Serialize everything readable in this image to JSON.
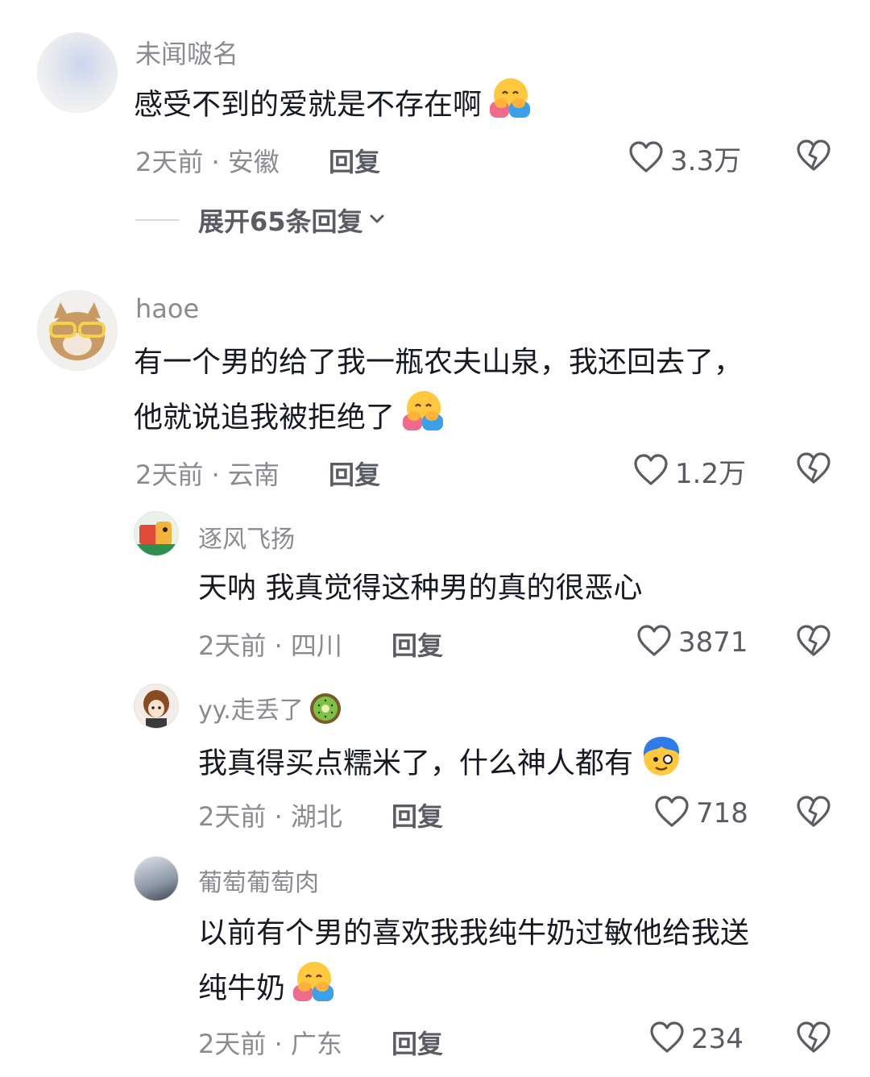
{
  "comments": [
    {
      "user": "未闻啵名",
      "text": "感受不到的爱就是不存在啊",
      "meta": "2天前 · 安徽",
      "reply": "回复",
      "likes": "3.3万",
      "expand": "展开65条回复"
    },
    {
      "user": "haoe",
      "text_line1": "有一个男的给了我一瓶农夫山泉，我还回去了，",
      "text_line2": "他就说追我被拒绝了",
      "meta": "2天前 · 云南",
      "reply": "回复",
      "likes": "1.2万",
      "replies": [
        {
          "user": "逐风飞扬",
          "text": "天呐 我真觉得这种男的真的很恶心",
          "meta": "2天前 · 四川",
          "reply": "回复",
          "likes": "3871"
        },
        {
          "user": "yy.走丢了",
          "text": "我真得买点糯米了，什么神人都有",
          "meta": "2天前 · 湖北",
          "reply": "回复",
          "likes": "718"
        },
        {
          "user": "葡萄葡萄肉",
          "text_line1": "以前有个男的喜欢我我纯牛奶过敏他给我送",
          "text_line2": "纯牛奶",
          "meta": "2天前 · 广东",
          "reply": "回复",
          "likes": "234"
        }
      ]
    }
  ],
  "icons": {
    "like": "heart-outline-icon",
    "dislike": "broken-heart-icon",
    "expand": "chevron-down-icon",
    "hug": "hugging-face-emoji",
    "kiwi": "kiwi-emoji"
  }
}
